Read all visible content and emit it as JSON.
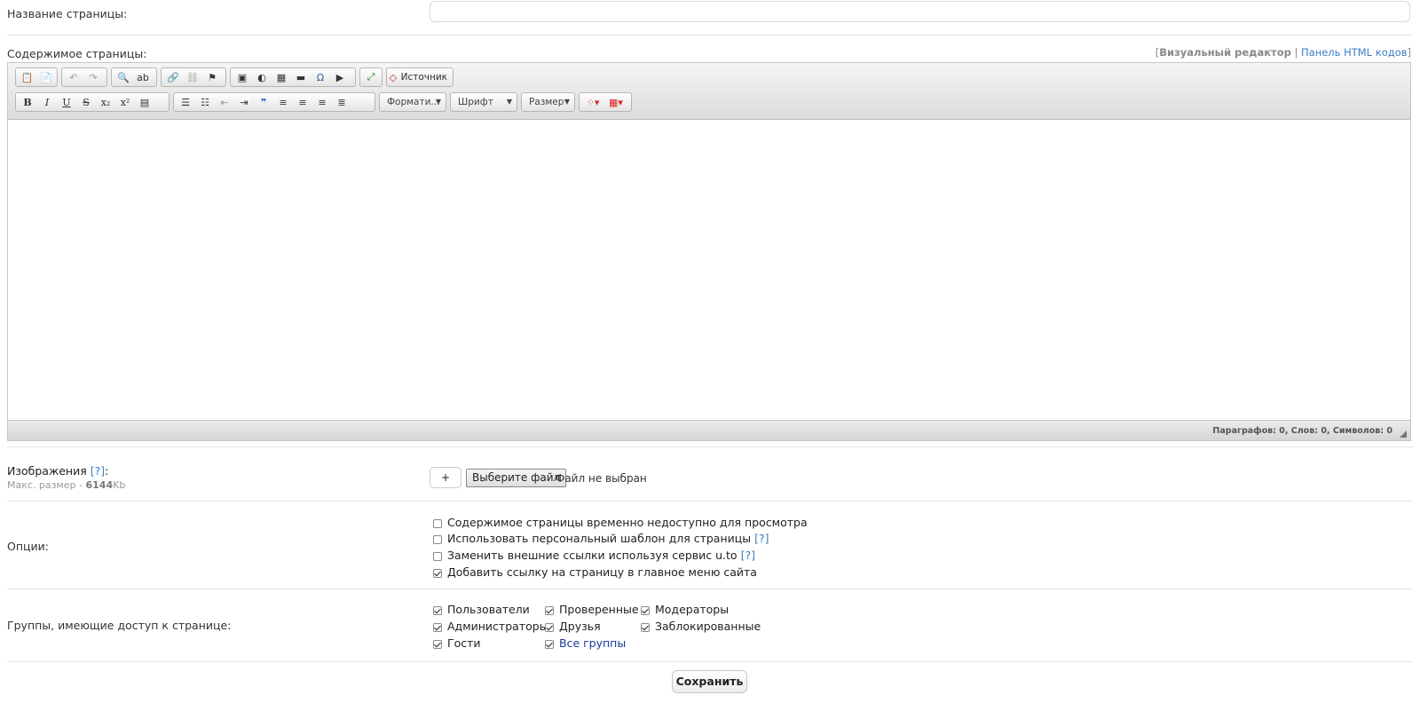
{
  "page_name": {
    "label": "Название страницы:",
    "value": ""
  },
  "content": {
    "label": "Содержимое страницы:",
    "switch": {
      "open": "[",
      "visual": "Визуальный редактор",
      "sep": " | ",
      "html": "Панель HTML кодов",
      "close": "]"
    },
    "toolbar": {
      "source_label": "Источник",
      "format_label": "Формати...",
      "font_label": "Шрифт",
      "size_label": "Размер"
    },
    "status": "Параграфов: 0, Слов: 0, Символов: 0"
  },
  "images": {
    "label": "Изображения",
    "help": "[?]",
    "colon": ":",
    "max_size_prefix": "Макс. размер - ",
    "max_size_value": "6144",
    "max_size_unit": "Kb",
    "plus_label": "+",
    "choose_file_label": "Выберите файл",
    "no_file_label": "Файл не выбран"
  },
  "options": {
    "label": "Опции:",
    "items": [
      {
        "text": "Содержимое страницы временно недоступно для просмотра",
        "help": "",
        "checked": false
      },
      {
        "text": "Использовать персональный шаблон для страницы",
        "help": "[?]",
        "checked": false
      },
      {
        "text": "Заменить внешние ссылки используя сервис u.to",
        "help": "[?]",
        "checked": false
      },
      {
        "text": "Добавить ссылку на страницу в главное меню сайта",
        "help": "",
        "checked": true
      }
    ]
  },
  "groups": {
    "label": "Группы, имеющие доступ к странице:",
    "items": [
      {
        "text": "Пользователи",
        "checked": true
      },
      {
        "text": "Проверенные",
        "checked": true
      },
      {
        "text": "Модераторы",
        "checked": true
      },
      {
        "text": "Администраторы",
        "checked": true
      },
      {
        "text": "Друзья",
        "checked": true
      },
      {
        "text": "Заблокированные",
        "checked": true
      },
      {
        "text": "Гости",
        "checked": true
      },
      {
        "text": "Все группы",
        "checked": true
      }
    ]
  },
  "save_label": "Сохранить"
}
